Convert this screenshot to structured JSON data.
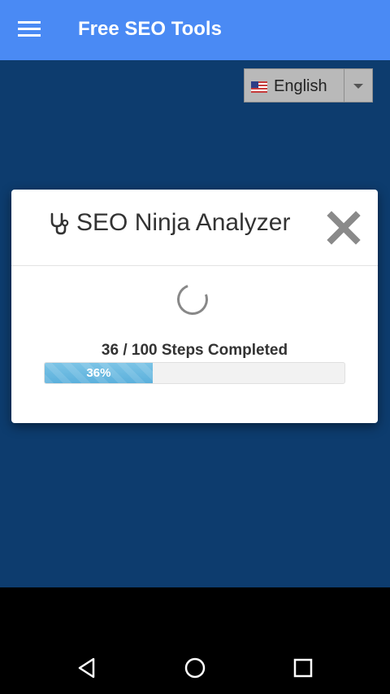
{
  "appbar": {
    "title": "Free SEO Tools",
    "menu_icon": "hamburger-menu-icon"
  },
  "language_selector": {
    "selected": "English",
    "flag_icon": "us-flag-icon"
  },
  "dialog": {
    "title": "SEO Ninja Analyzer",
    "title_icon": "stethoscope-icon",
    "close_icon": "close-x-icon",
    "steps_completed": 36,
    "steps_total": 100,
    "steps_text": "36 / 100 Steps Completed",
    "progress_percent": 36,
    "progress_label": "36%"
  },
  "colors": {
    "appbar": "#4a8af4",
    "background": "#0d3c6e",
    "progress_fill": "#6bbbe1"
  },
  "navbar": {
    "back_icon": "back-triangle-icon",
    "home_icon": "home-circle-icon",
    "recents_icon": "recents-square-icon"
  }
}
